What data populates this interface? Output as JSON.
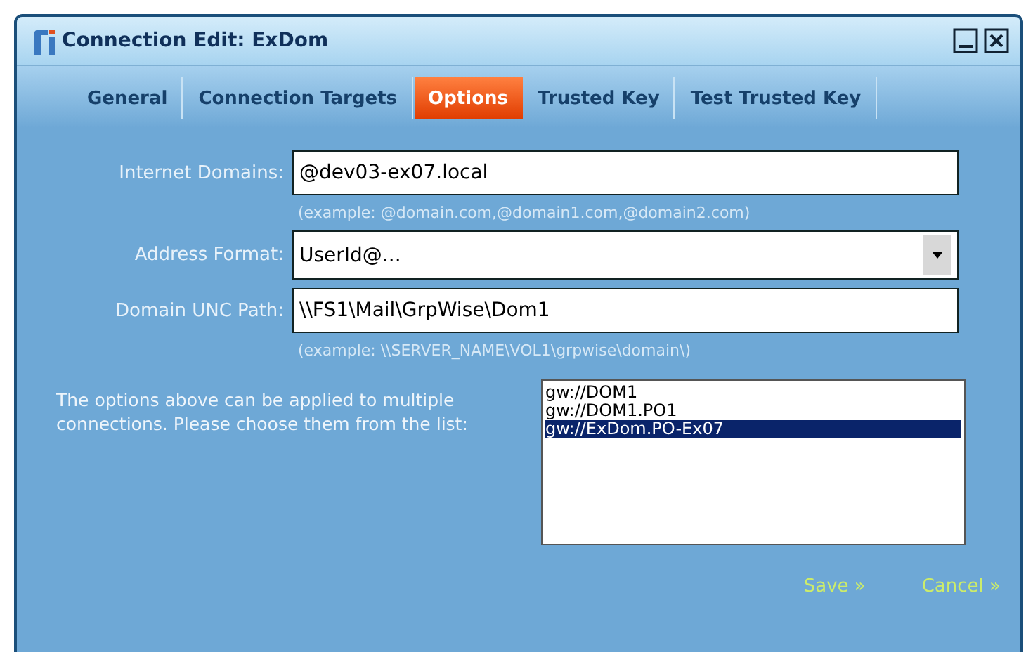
{
  "window": {
    "title": "Connection Edit: ExDom"
  },
  "tabs": [
    {
      "label": "General",
      "selected": false
    },
    {
      "label": "Connection Targets",
      "selected": false
    },
    {
      "label": "Options",
      "selected": true
    },
    {
      "label": "Trusted Key",
      "selected": false
    },
    {
      "label": "Test Trusted Key",
      "selected": false
    }
  ],
  "fields": [
    {
      "kind": "text",
      "label": "Internet Domains:",
      "value": "@dev03-ex07.local",
      "hint": "(example: @domain.com,@domain1.com,@domain2.com)"
    },
    {
      "kind": "select",
      "label": "Address Format:",
      "value": "UserId@..."
    },
    {
      "kind": "text",
      "label": "Domain UNC Path:",
      "value": "\\\\FS1\\Mail\\GrpWise\\Dom1",
      "hint": "(example: \\\\SERVER_NAME\\VOL1\\grpwise\\domain\\)"
    }
  ],
  "connections_note": "The options above can be applied to multiple connections. Please choose them from the list:",
  "connections": [
    {
      "label": "gw://DOM1",
      "selected": false
    },
    {
      "label": "gw://DOM1.PO1",
      "selected": false
    },
    {
      "label": "gw://ExDom.PO-Ex07",
      "selected": true
    }
  ],
  "buttons": [
    "Save »",
    "Cancel »"
  ]
}
